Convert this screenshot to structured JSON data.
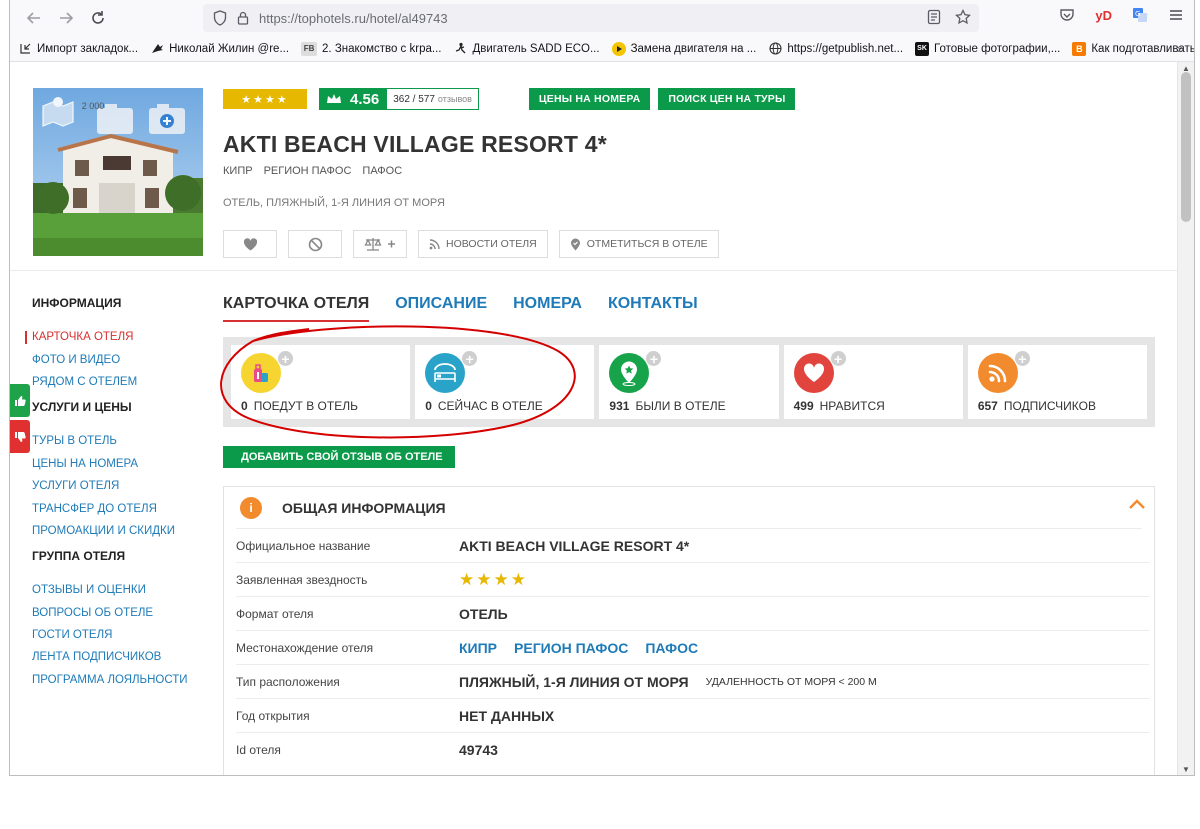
{
  "browser": {
    "url_host": "https://tophotels.ru",
    "url_path": "/hotel/al49743",
    "extension_label": "yD"
  },
  "bookmarks": [
    {
      "label": "Импорт закладок...",
      "icon": "import-icon"
    },
    {
      "label": "Николай Жилин @re...",
      "icon": "bird-icon"
    },
    {
      "label": "2. Знакомство с krpa...",
      "icon": "fb-icon"
    },
    {
      "label": "Двигатель SADD ECO...",
      "icon": "figure-icon"
    },
    {
      "label": "Замена двигателя на ...",
      "icon": "play-icon"
    },
    {
      "label": "https://getpublish.net...",
      "icon": "globe-icon"
    },
    {
      "label": "Готовые фотографии,...",
      "icon": "sk-icon"
    },
    {
      "label": "Как подготавливать ...",
      "icon": "blogger-icon"
    }
  ],
  "hotel": {
    "photo_count": "2 000",
    "stars": "★★★★",
    "rating": "4.56",
    "reviews_count": "362 / 577",
    "reviews_label": "отзывов",
    "btn_room_prices": "ЦЕНЫ НА НОМЕРА",
    "btn_tour_search": "ПОИСК ЦЕН НА ТУРЫ",
    "name": "AKTI BEACH VILLAGE RESORT 4*",
    "location": [
      "КИПР",
      "РЕГИОН ПАФОС",
      "ПАФОС"
    ],
    "type": "ОТЕЛЬ, ПЛЯЖНЫЙ, 1-Я ЛИНИЯ ОТ МОРЯ",
    "btn_news": "НОВОСТИ ОТЕЛЯ",
    "btn_checkin": "ОТМЕТИТЬСЯ В ОТЕЛЕ"
  },
  "sidebar": {
    "groups": [
      {
        "title": "ИНФОРМАЦИЯ",
        "items": [
          "КАРТОЧКА ОТЕЛЯ",
          "ФОТО И ВИДЕО",
          "РЯДОМ С ОТЕЛЕМ"
        ]
      },
      {
        "title": "УСЛУГИ И ЦЕНЫ",
        "items": [
          "ТУРЫ В ОТЕЛЬ",
          "ЦЕНЫ НА НОМЕРА",
          "УСЛУГИ ОТЕЛЯ",
          "ТРАНСФЕР ДО ОТЕЛЯ",
          "ПРОМОАКЦИИ И СКИДКИ"
        ]
      },
      {
        "title": "ГРУППА ОТЕЛЯ",
        "items": [
          "ОТЗЫВЫ И ОЦЕНКИ",
          "ВОПРОСЫ ОБ ОТЕЛЕ",
          "ГОСТИ ОТЕЛЯ",
          "ЛЕНТА ПОДПИСЧИКОВ",
          "ПРОГРАММА ЛОЯЛЬНОСТИ"
        ]
      }
    ]
  },
  "tabs": [
    "КАРТОЧКА ОТЕЛЯ",
    "ОПИСАНИЕ",
    "НОМЕРА",
    "КОНТАКТЫ"
  ],
  "stats": [
    {
      "count": "0",
      "label": "ПОЕДУТ В ОТЕЛЬ",
      "icon": "luggage-icon",
      "color": "#f7d531"
    },
    {
      "count": "0",
      "label": "СЕЙЧАС В ОТЕЛЕ",
      "icon": "bed-icon",
      "color": "#2aa3c9"
    },
    {
      "count": "931",
      "label": "БЫЛИ В ОТЕЛЕ",
      "icon": "map-pin-icon",
      "color": "#17a34a"
    },
    {
      "count": "499",
      "label": "НРАВИТСЯ",
      "icon": "heart-icon",
      "color": "#e0443c"
    },
    {
      "count": "657",
      "label": "ПОДПИСЧИКОВ",
      "icon": "rss-icon",
      "color": "#f28a2e"
    }
  ],
  "review_button": "ДОБАВИТЬ СВОЙ ОТЗЫВ ОБ ОТЕЛЕ",
  "info": {
    "title": "ОБЩАЯ ИНФОРМАЦИЯ",
    "rows": [
      {
        "key": "Официальное название",
        "value": "AKTI BEACH VILLAGE RESORT 4*"
      },
      {
        "key": "Заявленная звездность",
        "value": "★★★★"
      },
      {
        "key": "Формат отеля",
        "value": "ОТЕЛЬ"
      },
      {
        "key": "Местонахождение отеля",
        "links": [
          "КИПР",
          "РЕГИОН ПАФОС",
          "ПАФОС"
        ]
      },
      {
        "key": "Тип расположения",
        "value": "ПЛЯЖНЫЙ, 1-Я ЛИНИЯ ОТ МОРЯ",
        "extra": "УДАЛЕННОСТЬ ОТ МОРЯ < 200 М"
      },
      {
        "key": "Год открытия",
        "value": "НЕТ ДАННЫХ"
      },
      {
        "key": "Id отеля",
        "value": "49743"
      }
    ]
  },
  "colors": {
    "green": "#0b9a4a",
    "blue_link": "#1e7bb8",
    "red_accent": "#d63030",
    "gold": "#e6b800",
    "annotation": "#d40000"
  }
}
